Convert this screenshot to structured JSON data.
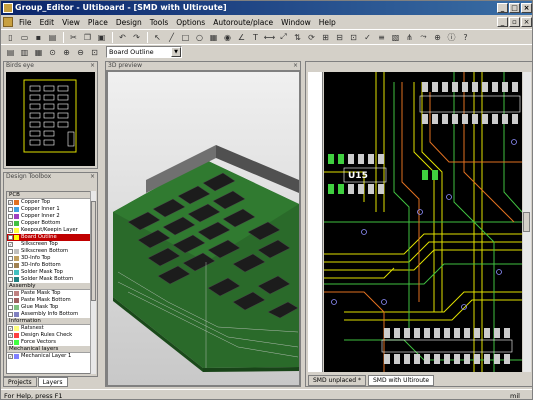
{
  "window": {
    "title": "Group_Editor - Ultiboard - [SMD with Ultiroute]"
  },
  "menu": [
    "File",
    "Edit",
    "View",
    "Place",
    "Design",
    "Tools",
    "Options",
    "Autoroute/place",
    "Window",
    "Help"
  ],
  "toolbar2": {
    "layer_select": "Board Outline"
  },
  "birdseye": {
    "title": "Birds eye"
  },
  "preview": {
    "title": "3D preview"
  },
  "toolbox": {
    "title": "Design Toolbox"
  },
  "layers": {
    "groups": [
      {
        "name": "PCB",
        "rows": [
          {
            "label": "Copper Top",
            "color": "#e07020",
            "checked": true
          },
          {
            "label": "Copper Inner 1",
            "color": "#40a0e0",
            "checked": false
          },
          {
            "label": "Copper Inner 2",
            "color": "#a040c0",
            "checked": false
          },
          {
            "label": "Copper Bottom",
            "color": "#40c040",
            "checked": true
          },
          {
            "label": "Keepout/Keepin Layer",
            "color": "#ffff40",
            "checked": true
          },
          {
            "label": "Board Outline",
            "color": "#ffff00",
            "checked": true,
            "selected": true
          },
          {
            "label": "Silkscreen Top",
            "color": "#ffffff",
            "checked": true
          },
          {
            "label": "Silkscreen Bottom",
            "color": "#c0c0c0",
            "checked": false
          },
          {
            "label": "3D-Info Top",
            "color": "#c0a060",
            "checked": false
          },
          {
            "label": "3D-Info Bottom",
            "color": "#a08050",
            "checked": false
          },
          {
            "label": "Solder Mask Top",
            "color": "#40c0c0",
            "checked": false
          },
          {
            "label": "Solder Mask Bottom",
            "color": "#208080",
            "checked": false
          }
        ]
      },
      {
        "name": "Assembly",
        "rows": [
          {
            "label": "Paste Mask Top",
            "color": "#c08080",
            "checked": false
          },
          {
            "label": "Paste Mask Bottom",
            "color": "#a06060",
            "checked": false
          },
          {
            "label": "Glue Mask Top",
            "color": "#80c080",
            "checked": false
          },
          {
            "label": "Assembly Info Bottom",
            "color": "#8080c0",
            "checked": false
          }
        ]
      },
      {
        "name": "Information",
        "rows": [
          {
            "label": "Ratsnest",
            "color": "#ffff80",
            "checked": true
          },
          {
            "label": "Design Rules Check",
            "color": "#ff4040",
            "checked": true
          },
          {
            "label": "Force Vectors",
            "color": "#40ff40",
            "checked": true
          }
        ]
      },
      {
        "name": "Mechanical layers",
        "rows": [
          {
            "label": "Mechanical Layer 1",
            "color": "#8080ff",
            "checked": true
          }
        ]
      }
    ]
  },
  "tabs": {
    "projects": "Projects",
    "layers": "Layers"
  },
  "doc_tabs": {
    "tab1": "SMD unplaced *",
    "tab2": "SMD with Ultiroute"
  },
  "status": {
    "help": "For Help, press F1",
    "unit": "mil"
  },
  "colors": {
    "title_start": "#0a246a",
    "title_end": "#3a6ea5",
    "pcb_bg": "#000000",
    "trace_yellow": "#e0e000",
    "trace_green": "#40c040",
    "trace_orange": "#e07020",
    "board_green": "#206020"
  }
}
